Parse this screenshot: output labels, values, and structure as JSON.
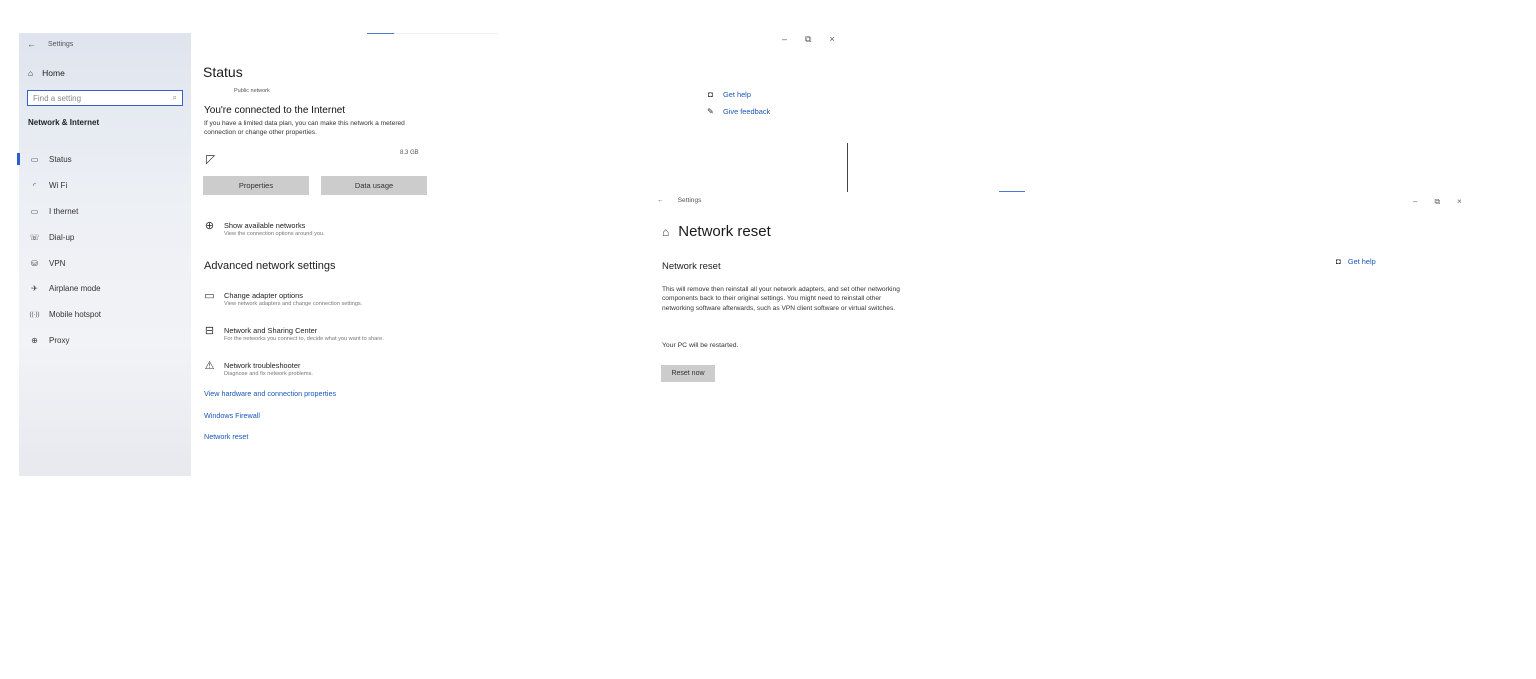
{
  "window1": {
    "titlebar": {
      "back": "←",
      "title": "Settings"
    },
    "sidebar": {
      "home": {
        "icon": "⌂",
        "label": "Home"
      },
      "search": {
        "placeholder": "Find a setting",
        "icon": "⌕"
      },
      "section": "Network & Internet",
      "items": [
        {
          "icon": "▭",
          "label": "Status"
        },
        {
          "icon": "◜",
          "label": "Wi Fi"
        },
        {
          "icon": "▭",
          "label": "I thernet"
        },
        {
          "icon": "☏",
          "label": "Dial-up"
        },
        {
          "icon": "⛁",
          "label": "VPN"
        },
        {
          "icon": "✈",
          "label": "Airplane mode"
        },
        {
          "icon": "((·))",
          "label": "Mobile hotspot"
        },
        {
          "icon": "⊕",
          "label": "Proxy"
        }
      ]
    },
    "content": {
      "title": "Status",
      "network_type": "Public network",
      "connected": "You're connected to the Internet",
      "metered_text": "If you have a limited data plan, you can make this network a metered connection or change other properties.",
      "wifi_icon": "◸",
      "data_size": "8.3 GB",
      "properties_label": "Properties",
      "data_usage_label": "Data usage",
      "show_networks": {
        "icon": "⊕",
        "title": "Show available networks",
        "sub": "View the connection options around you."
      },
      "advanced_heading": "Advanced network settings",
      "adapter": {
        "icon": "▭",
        "title": "Change adapter options",
        "sub": "View network adapters and change connection settings."
      },
      "sharing": {
        "icon": "⊟",
        "title": "Network and Sharing Center",
        "sub": "For the networks you connect to, decide what you want to share."
      },
      "troubleshooter": {
        "icon": "⚠",
        "title": "Network troubleshooter",
        "sub": "Diagnose and fix network problems."
      },
      "links": {
        "hardware": "View hardware and connection properties",
        "firewall": "Windows Firewall",
        "reset": "Network reset"
      }
    },
    "controls": {
      "minimize": "–",
      "restore": "⧉",
      "close": "×"
    },
    "help": {
      "get_help": {
        "icon": "◘",
        "label": "Get help"
      },
      "feedback": {
        "icon": "✎",
        "label": "Give feedback"
      }
    }
  },
  "window2": {
    "titlebar": {
      "back": "←",
      "title": "Settings"
    },
    "controls": {
      "minimize": "–",
      "restore": "⧉",
      "close": "×"
    },
    "header": {
      "icon": "⌂",
      "title": "Network reset"
    },
    "subtitle": "Network reset",
    "description": "This will remove then reinstall all your network adapters, and set other networking components back to their original settings. You might need to reinstall other networking software afterwards, such as VPN client software or virtual switches.",
    "restart_note": "Your PC will be restarted.",
    "reset_button": "Reset now",
    "help": {
      "icon": "◘",
      "label": "Get help"
    }
  }
}
